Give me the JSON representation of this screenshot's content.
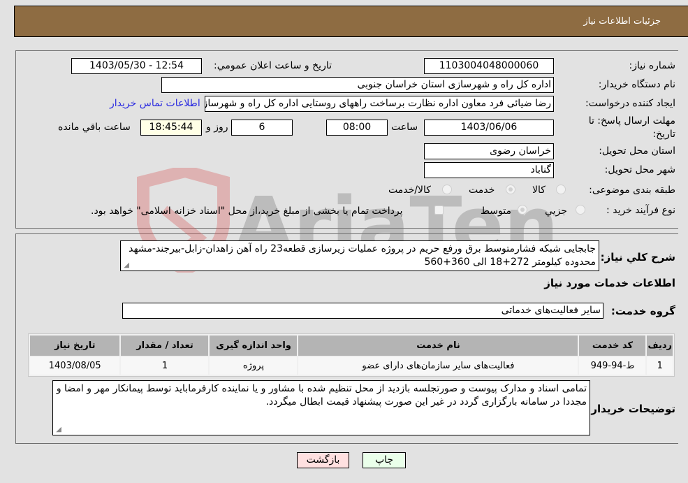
{
  "header": {
    "title": "جزئیات اطلاعات نیاز"
  },
  "fields": {
    "need_number_label": "شماره نیاز:",
    "need_number": "1103004048000060",
    "announce_label": "تاریخ و ساعت اعلان عمومي:",
    "announce_value": "1403/05/30 - 12:54",
    "buyer_org_label": "نام دستگاه خريدار:",
    "buyer_org": "اداره کل راه و شهرسازی استان خراسان جنوبی",
    "creator_label": "ايجاد کننده درخواست:",
    "creator": "رضا ضیائی فرد معاون اداره نظارت برساخت راههای روستایی اداره کل راه و شهرسازی",
    "contact_link": "اطلاعات تماس خريدار",
    "deadline_label": "مهلت ارسال پاسخ: تا تاریخ:",
    "deadline_date": "1403/06/06",
    "time_label": "ساعت",
    "deadline_time": "08:00",
    "days_value": "6",
    "days_label": "روز و",
    "remaining_time": "18:45:44",
    "remaining_label": "ساعت باقي مانده",
    "province_label": "استان محل تحویل:",
    "province": "خراسان رضوی",
    "city_label": "شهر محل تحویل:",
    "city": "گناباد",
    "category_label": "طبقه بندی موضوعی:",
    "category_options": [
      {
        "label": "کالا",
        "checked": false
      },
      {
        "label": "خدمت",
        "checked": true
      },
      {
        "label": "کالا/خدمت",
        "checked": false
      }
    ],
    "purchase_type_label": "نوع فرآيند خريد :",
    "purchase_options": [
      {
        "label": "جزيي",
        "checked": false
      },
      {
        "label": "متوسط",
        "checked": true
      }
    ],
    "treasury_note": "پرداخت تمام یا بخشی از مبلغ خرید،از محل \"اسناد خزانه اسلامی\" خواهد بود."
  },
  "description": {
    "label": "شرح کلي نياز:",
    "text": "جابجایی شبکه فشارمتوسط برق ورفع حریم در پروژه عملیات زیرسازی قطعه23 راه آهن زاهدان-زابل-بیرجند-مشهد محدوده کیلومتر 272+18 الی 360+560"
  },
  "services": {
    "section_title": "اطلاعات خدمات مورد نياز",
    "group_label": "گروه خدمت:",
    "group_value": "سایر فعالیت‌های خدماتی",
    "columns": [
      "رديف",
      "کد خدمت",
      "نام خدمت",
      "واحد اندازه گيری",
      "تعداد / مقدار",
      "تاريخ نياز"
    ],
    "rows": [
      [
        "1",
        "ط-94-949",
        "فعالیت‌های سایر سازمان‌های دارای عضو",
        "پروژه",
        "1",
        "1403/08/05"
      ]
    ]
  },
  "buyer_notes": {
    "label": "توضيحات خريدار:",
    "text": "تمامی اسناد و مدارک پیوست و صورتجلسه بازدید از محل تنظیم شده با مشاور و یا نماینده کارفرمابايد توسط پیمانکار مهر و امضا و مجددا در سامانه بارگزاری گردد در غیر این صورت پیشنهاد قیمت ابطال میگردد."
  },
  "buttons": {
    "print": "چاپ",
    "back": "بازگشت"
  },
  "watermark": {
    "text": "AriaTender.neT"
  },
  "colors": {
    "header_bg": "#8e6c42",
    "print_bg": "#eaffea",
    "back_bg": "#ffe0e0",
    "link": "#2a2ae0"
  }
}
